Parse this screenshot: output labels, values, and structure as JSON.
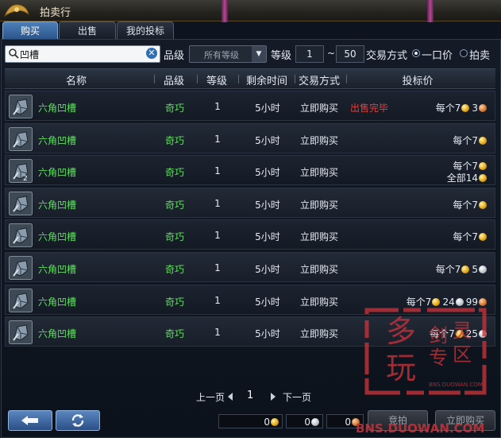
{
  "window": {
    "title": "拍卖行"
  },
  "tabs": [
    {
      "label": "购买",
      "active": true
    },
    {
      "label": "出售",
      "active": false
    },
    {
      "label": "我的投标",
      "active": false
    }
  ],
  "filters": {
    "search_value": "凹槽",
    "grade_label": "品级",
    "grade_select": "所有等级",
    "level_label": "等级",
    "level_min": "1",
    "level_sep": "~",
    "level_max": "50",
    "trade_label": "交易方式",
    "trade_options": [
      {
        "label": "一口价",
        "selected": true
      },
      {
        "label": "拍卖",
        "selected": false
      }
    ]
  },
  "table": {
    "headers": [
      "名称",
      "品级",
      "等级",
      "剩余时间",
      "交易方式",
      "投标价"
    ],
    "rows": [
      {
        "name": "六角凹槽",
        "grade": "奇巧",
        "level": "1",
        "time": "5小时",
        "trade": "立即购买",
        "status": "出售完毕",
        "price": [
          {
            "line": [
              {
                "t": "每个7",
                "c": "gold"
              },
              {
                "t": "3",
                "c": "copper"
              }
            ]
          }
        ],
        "qty": ""
      },
      {
        "name": "六角凹槽",
        "grade": "奇巧",
        "level": "1",
        "time": "5小时",
        "trade": "立即购买",
        "status": "",
        "price": [
          {
            "line": [
              {
                "t": "每个7",
                "c": "gold"
              }
            ]
          }
        ],
        "qty": ""
      },
      {
        "name": "六角凹槽",
        "grade": "奇巧",
        "level": "1",
        "time": "5小时",
        "trade": "立即购买",
        "status": "",
        "price": [
          {
            "line": [
              {
                "t": "每个7",
                "c": "gold"
              }
            ]
          },
          {
            "line": [
              {
                "t": "全部14",
                "c": "gold"
              }
            ]
          }
        ],
        "qty": "2"
      },
      {
        "name": "六角凹槽",
        "grade": "奇巧",
        "level": "1",
        "time": "5小时",
        "trade": "立即购买",
        "status": "",
        "price": [
          {
            "line": [
              {
                "t": "每个7",
                "c": "gold"
              }
            ]
          }
        ],
        "qty": ""
      },
      {
        "name": "六角凹槽",
        "grade": "奇巧",
        "level": "1",
        "time": "5小时",
        "trade": "立即购买",
        "status": "",
        "price": [
          {
            "line": [
              {
                "t": "每个7",
                "c": "gold"
              }
            ]
          }
        ],
        "qty": ""
      },
      {
        "name": "六角凹槽",
        "grade": "奇巧",
        "level": "1",
        "time": "5小时",
        "trade": "立即购买",
        "status": "",
        "price": [
          {
            "line": [
              {
                "t": "每个7",
                "c": "gold"
              },
              {
                "t": "5",
                "c": "silver"
              }
            ]
          }
        ],
        "qty": ""
      },
      {
        "name": "六角凹槽",
        "grade": "奇巧",
        "level": "1",
        "time": "5小时",
        "trade": "立即购买",
        "status": "",
        "price": [
          {
            "line": [
              {
                "t": "每个7",
                "c": "gold"
              },
              {
                "t": "24",
                "c": "silver"
              },
              {
                "t": "99",
                "c": "copper"
              }
            ]
          }
        ],
        "qty": ""
      },
      {
        "name": "六角凹槽",
        "grade": "奇巧",
        "level": "1",
        "time": "5小时",
        "trade": "立即购买",
        "status": "",
        "price": [
          {
            "line": [
              {
                "t": "每个7",
                "c": "gold"
              },
              {
                "t": "25",
                "c": "silver"
              }
            ]
          }
        ],
        "qty": ""
      }
    ]
  },
  "pager": {
    "prev": "上一页",
    "page": "1",
    "next": "下一页"
  },
  "money": {
    "gold": "0",
    "silver": "0",
    "copper": "0"
  },
  "actions": {
    "bid": "竞拍",
    "buynow": "立即购买"
  },
  "watermark": {
    "stamp_chars": [
      "多",
      "玩",
      "剑",
      "灵",
      "专",
      "区"
    ],
    "stamp_url": "BNS.DUOWAN.COM",
    "bottom_url": "BNS.DUOWAN.COM"
  },
  "colors": {
    "accent": "#4d7fb8",
    "item_name": "#5fe05f",
    "status_sold": "#e0413c",
    "stamp": "#c8323a"
  },
  "icons": [
    "search-icon",
    "clear-icon",
    "chevron-down-icon",
    "chevron-left-icon",
    "chevron-right-icon",
    "back-arrow-icon",
    "refresh-icon",
    "gold-coin-icon",
    "silver-coin-icon",
    "copper-coin-icon",
    "hexagon-groove-icon"
  ]
}
